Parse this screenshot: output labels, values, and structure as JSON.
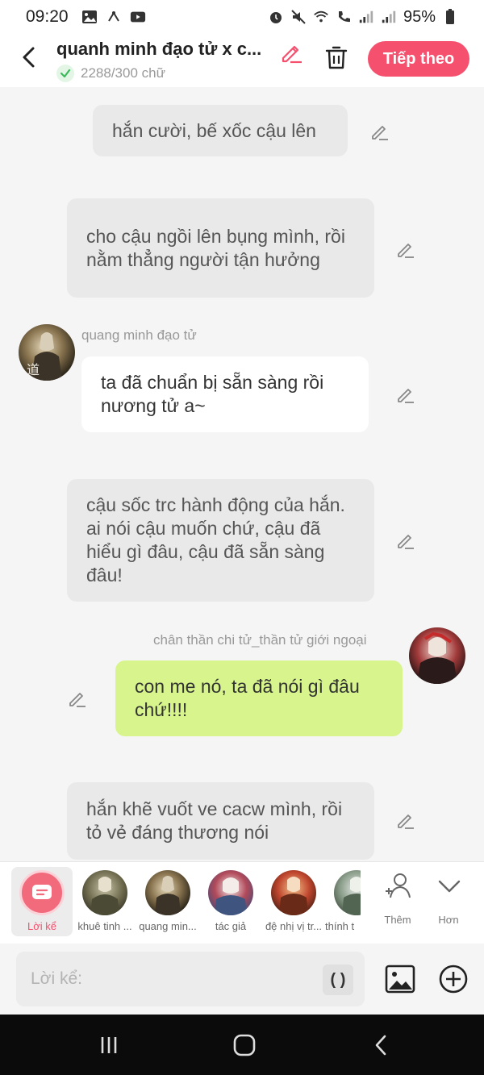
{
  "status_bar": {
    "time": "09:20",
    "battery": "95%"
  },
  "header": {
    "title": "quanh minh đạo tử x c...",
    "word_count": "2288/300 chữ",
    "next_label": "Tiếp theo"
  },
  "messages": [
    {
      "type": "narration",
      "text": "hắn cười, bế xốc cậu lên"
    },
    {
      "type": "narration",
      "text": "cho cậu ngồi lên bụng mình, rồi nằm thẳng người tận hưởng"
    },
    {
      "type": "character",
      "side": "left",
      "name": "quang minh đạo tử",
      "text": "ta đã chuẩn bị sẵn sàng rồi nương tử a~"
    },
    {
      "type": "narration",
      "text": "cậu sốc trc hành động của hắn. ai nói  cậu muốn chứ, cậu đã hiểu gì đâu, cậu đã sẵn sàng đâu!"
    },
    {
      "type": "character",
      "side": "right",
      "name": "chân thần chi tử_thần tử giới ngoại",
      "text": "con me nó, ta đã nói gì đâu chứ!!!!"
    },
    {
      "type": "narration",
      "text": "hắn khẽ vuốt ve cacw mình, rồi tỏ vẻ đáng thương nói"
    }
  ],
  "character_strip": {
    "narrator_label": "Lời kể",
    "characters": [
      {
        "label": "khuê tinh ..."
      },
      {
        "label": "quang min..."
      },
      {
        "label": "tác giả"
      },
      {
        "label": "đệ nhị vị tr..."
      },
      {
        "label": "thính t"
      }
    ],
    "add_label": "Thêm",
    "more_label": "Hơn"
  },
  "input": {
    "placeholder": "Lời kể:",
    "paren_label": "( )"
  },
  "colors": {
    "accent": "#f5506e",
    "narration_bg": "#e9e9e9",
    "right_bubble_bg": "#d7f58c",
    "left_bubble_bg": "#ffffff"
  }
}
